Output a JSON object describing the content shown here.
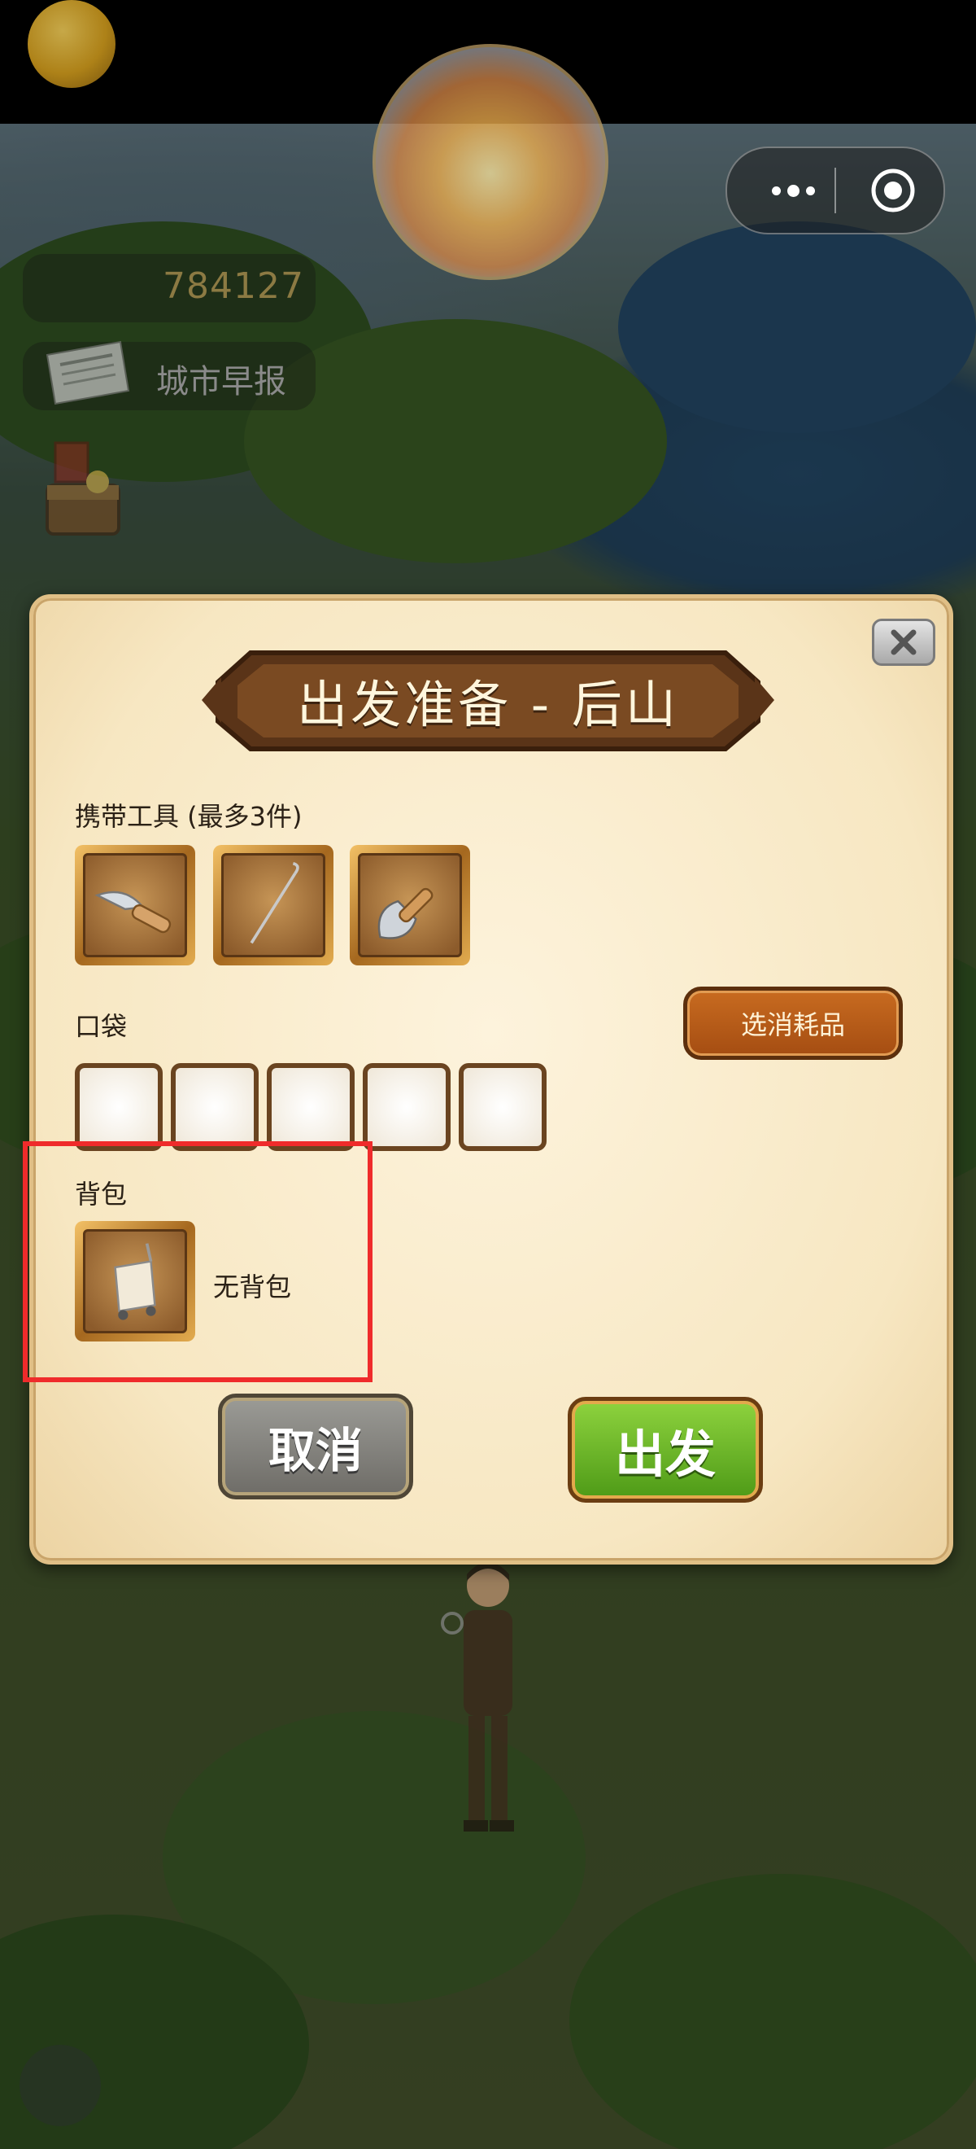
{
  "currency": {
    "coins": "784127"
  },
  "news": {
    "label": "城市早报"
  },
  "dialog": {
    "title": "出发准备 - 后山",
    "tools_label": "携带工具 (最多3件)",
    "tools": [
      {
        "icon": "knife-icon"
      },
      {
        "icon": "hook-stick-icon"
      },
      {
        "icon": "trowel-icon"
      }
    ],
    "pocket_label": "口袋",
    "pocket_slots": 5,
    "consumables_button": "选消耗品",
    "backpack_label": "背包",
    "backpack_status": "无背包",
    "backpack_icon": "backpack-cart-icon",
    "cancel_button": "取消",
    "go_button": "出发"
  },
  "colors": {
    "highlight": "#ef2b2b",
    "go_button": "#6cbf26",
    "cancel_button": "#85837d",
    "dialog_bg": "#f7e7c2"
  }
}
